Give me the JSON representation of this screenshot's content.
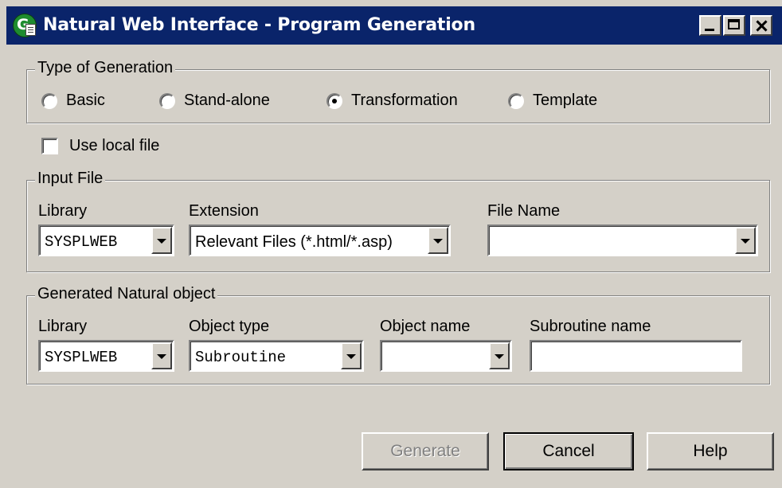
{
  "window": {
    "title": "Natural Web Interface - Program Generation"
  },
  "type_of_generation": {
    "legend": "Type of Generation",
    "options": [
      {
        "label": "Basic",
        "selected": false
      },
      {
        "label": "Stand-alone",
        "selected": false
      },
      {
        "label": "Transformation",
        "selected": true
      },
      {
        "label": "Template",
        "selected": false
      }
    ]
  },
  "use_local_file": {
    "label": "Use local file",
    "checked": false
  },
  "input_file": {
    "legend": "Input File",
    "library_label": "Library",
    "library_value": "SYSPLWEB",
    "extension_label": "Extension",
    "extension_value": "Relevant Files (*.html/*.asp)",
    "file_name_label": "File Name",
    "file_name_value": ""
  },
  "generated_object": {
    "legend": "Generated Natural object",
    "library_label": "Library",
    "library_value": "SYSPLWEB",
    "object_type_label": "Object type",
    "object_type_value": "Subroutine",
    "object_name_label": "Object name",
    "object_name_value": "",
    "subroutine_name_label": "Subroutine name",
    "subroutine_name_value": ""
  },
  "buttons": {
    "generate": "Generate",
    "cancel": "Cancel",
    "help": "Help"
  }
}
